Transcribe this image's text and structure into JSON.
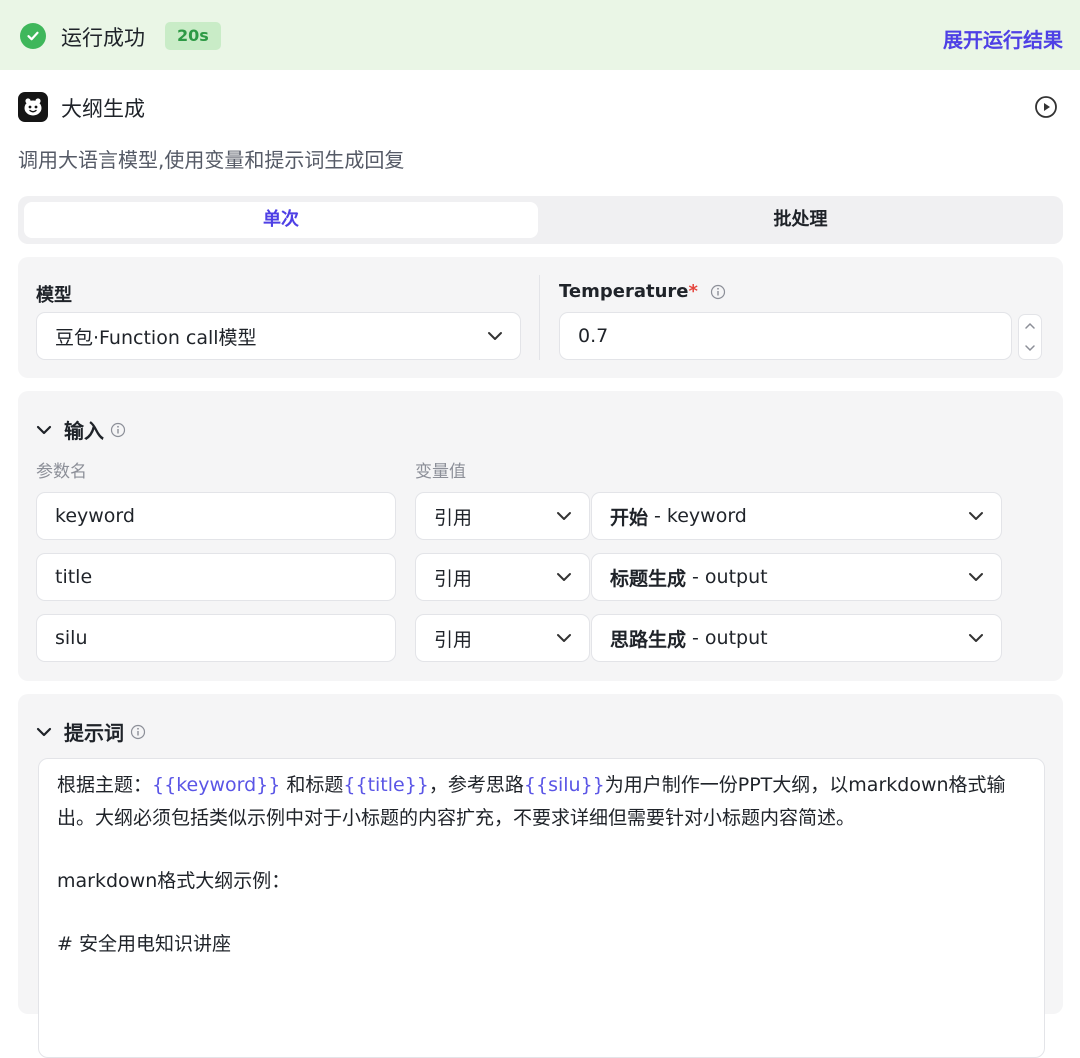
{
  "status": {
    "text": "运行成功",
    "duration": "20s",
    "expand_label": "展开运行结果"
  },
  "node": {
    "title": "大纲生成",
    "description": "调用大语言模型,使用变量和提示词生成回复"
  },
  "tabs": {
    "single": "单次",
    "batch": "批处理"
  },
  "model": {
    "label": "模型",
    "value": "豆包·Function call模型",
    "temperature_label": "Temperature",
    "required_mark": "*",
    "temperature_value": "0.7"
  },
  "inputs": {
    "title": "输入",
    "param_header": "参数名",
    "value_header": "变量值",
    "rows": [
      {
        "name": "keyword",
        "type": "引用",
        "source": "开始",
        "field": "- keyword"
      },
      {
        "name": "title",
        "type": "引用",
        "source": "标题生成",
        "field": "- output"
      },
      {
        "name": "silu",
        "type": "引用",
        "source": "思路生成",
        "field": "- output"
      }
    ]
  },
  "prompt": {
    "title": "提示词",
    "line1_a": "根据主题：",
    "line1_var1": "{{keyword}}",
    "line1_b": " 和标题",
    "line1_var2": "{{title}}",
    "line1_c": "，参考思路",
    "line1_var3": "{{silu}}",
    "line1_d": "为用户制作一份PPT大纲，以markdown格式输",
    "line2": "出。大纲必须包括类似示例中对于小标题的内容扩充，不要求详细但需要针对小标题内容简述。",
    "line3": "markdown格式大纲示例：",
    "line4": "# 安全用电知识讲座"
  },
  "colors": {
    "accent": "#4e40e5",
    "success": "#3fb75b",
    "variable": "#5a55e6"
  },
  "icons": [
    "check-circle-icon",
    "robot-icon",
    "play-circle-icon",
    "info-icon",
    "chevron-down-icon",
    "stepper-icon"
  ]
}
